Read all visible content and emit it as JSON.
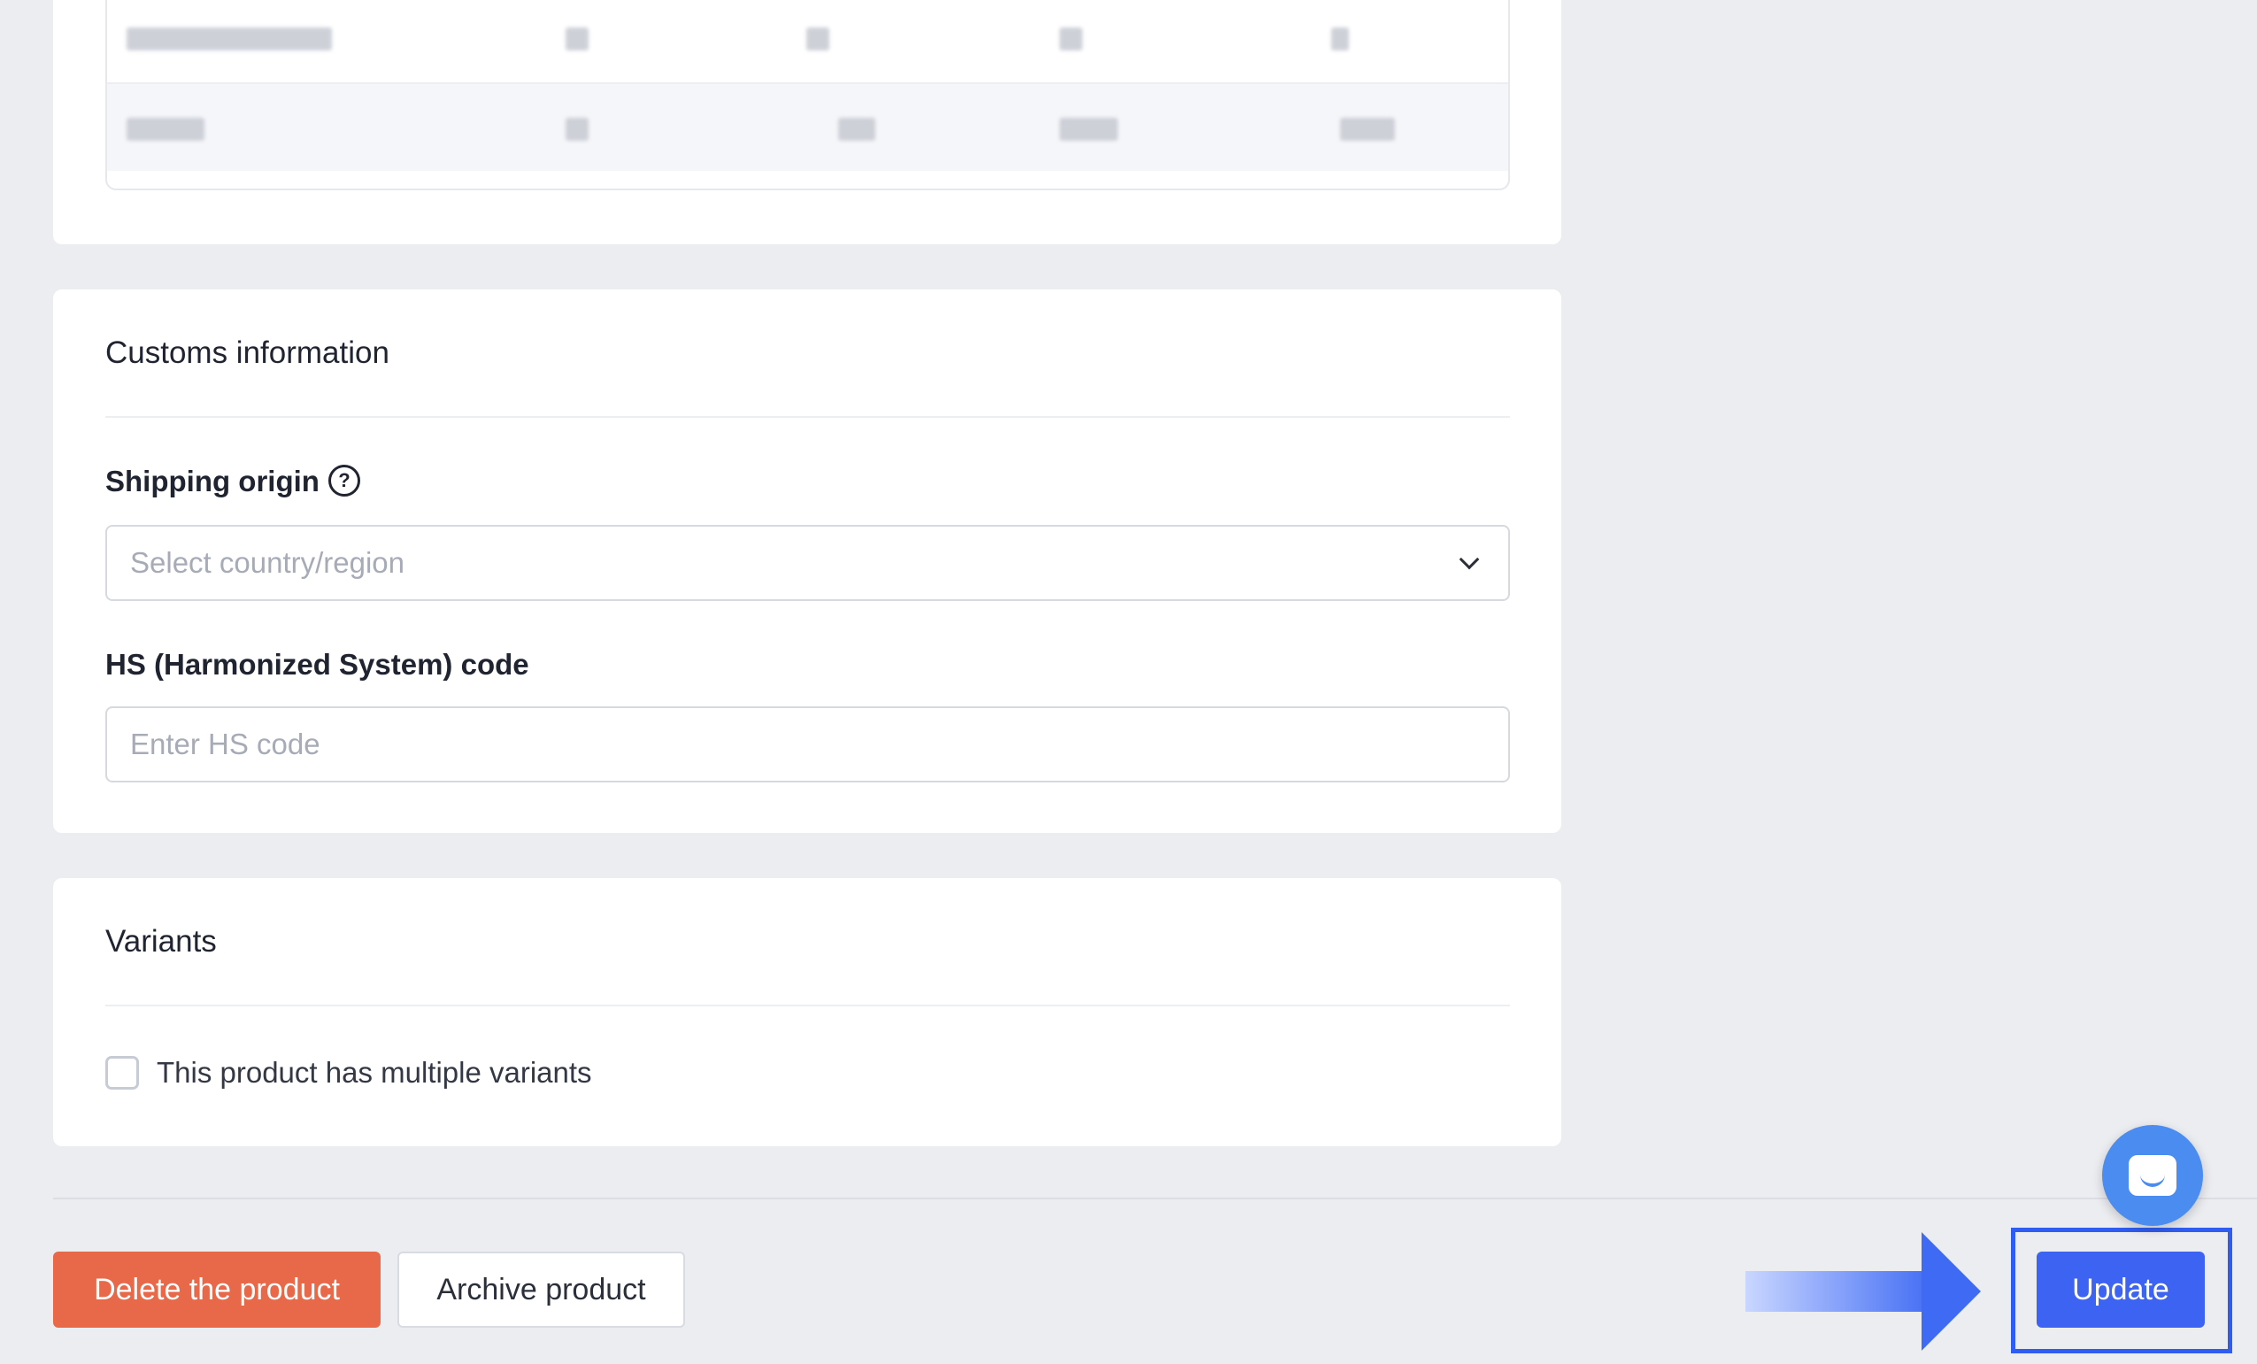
{
  "customs": {
    "title": "Customs information",
    "shipping_origin_label": "Shipping origin",
    "shipping_origin_placeholder": "Select country/region",
    "hs_code_label": "HS (Harmonized System) code",
    "hs_code_placeholder": "Enter HS code"
  },
  "variants": {
    "title": "Variants",
    "multiple_variants_label": "This product has multiple variants"
  },
  "footer": {
    "delete_label": "Delete the product",
    "archive_label": "Archive product",
    "update_label": "Update"
  },
  "icons": {
    "help": "?",
    "chat": "chat-icon"
  },
  "colors": {
    "primary": "#3d63f3",
    "danger": "#e8694a",
    "chat": "#4a8cf0"
  }
}
